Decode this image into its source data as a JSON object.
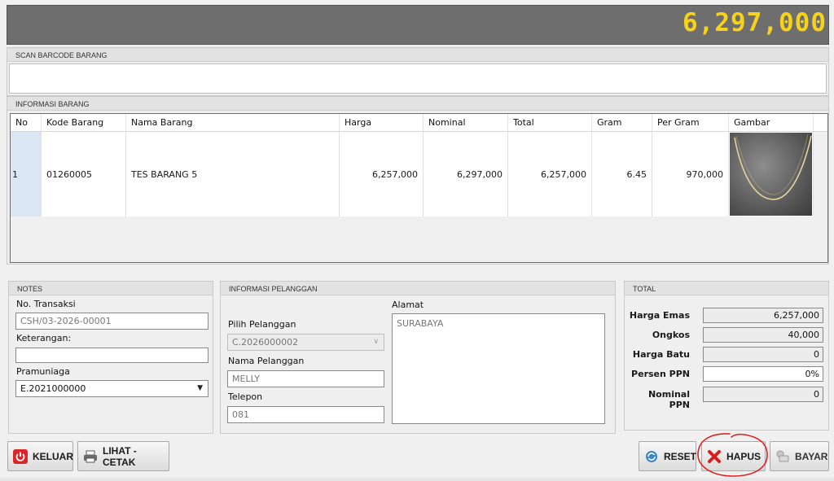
{
  "header": {
    "grand_total": "6,297,000"
  },
  "scan": {
    "title": "SCAN BARCODE BARANG",
    "value": ""
  },
  "items": {
    "title": "INFORMASI BARANG",
    "columns": [
      "No",
      "Kode Barang",
      "Nama Barang",
      "Harga",
      "Nominal",
      "Total",
      "Gram",
      "Per Gram",
      "Gambar"
    ],
    "rows": [
      {
        "no": "1",
        "kode": "01260005",
        "nama": "TES BARANG 5",
        "harga": "6,257,000",
        "nominal": "6,297,000",
        "total": "6,257,000",
        "gram": "6.45",
        "per_gram": "970,000",
        "gambar": "necklace-image"
      }
    ]
  },
  "notes": {
    "title": "NOTES",
    "no_transaksi_label": "No. Transaksi",
    "no_transaksi": "CSH/03-2026-00001",
    "keterangan_label": "Keterangan:",
    "keterangan": "",
    "pramuniaga_label": "Pramuniaga",
    "pramuniaga": "E.2021000000"
  },
  "pelanggan": {
    "title": "INFORMASI PELANGGAN",
    "pilih_label": "Pilih Pelanggan",
    "pilih": "C.2026000002",
    "nama_label": "Nama Pelanggan",
    "nama": "MELLY",
    "telepon_label": "Telepon",
    "telepon": "081",
    "alamat_label": "Alamat",
    "alamat": "SURABAYA"
  },
  "total": {
    "title": "TOTAL",
    "harga_emas_label": "Harga Emas",
    "harga_emas": "6,257,000",
    "ongkos_label": "Ongkos",
    "ongkos": "40,000",
    "harga_batu_label": "Harga Batu",
    "harga_batu": "0",
    "persen_ppn_label": "Persen PPN",
    "persen_ppn": "0%",
    "nominal_ppn_label": "Nominal PPN",
    "nominal_ppn": "0"
  },
  "buttons": {
    "keluar": "KELUAR",
    "lihat_cetak": "LIHAT - CETAK",
    "reset": "RESET",
    "hapus": "HAPUS",
    "bayar": "BAYAR"
  },
  "colors": {
    "grand_total": "#f7d21c",
    "topbar": "#6e6e6e",
    "annotation": "#e02020",
    "power_icon": "#d9262b",
    "hapus_icon": "#d61f1f"
  }
}
